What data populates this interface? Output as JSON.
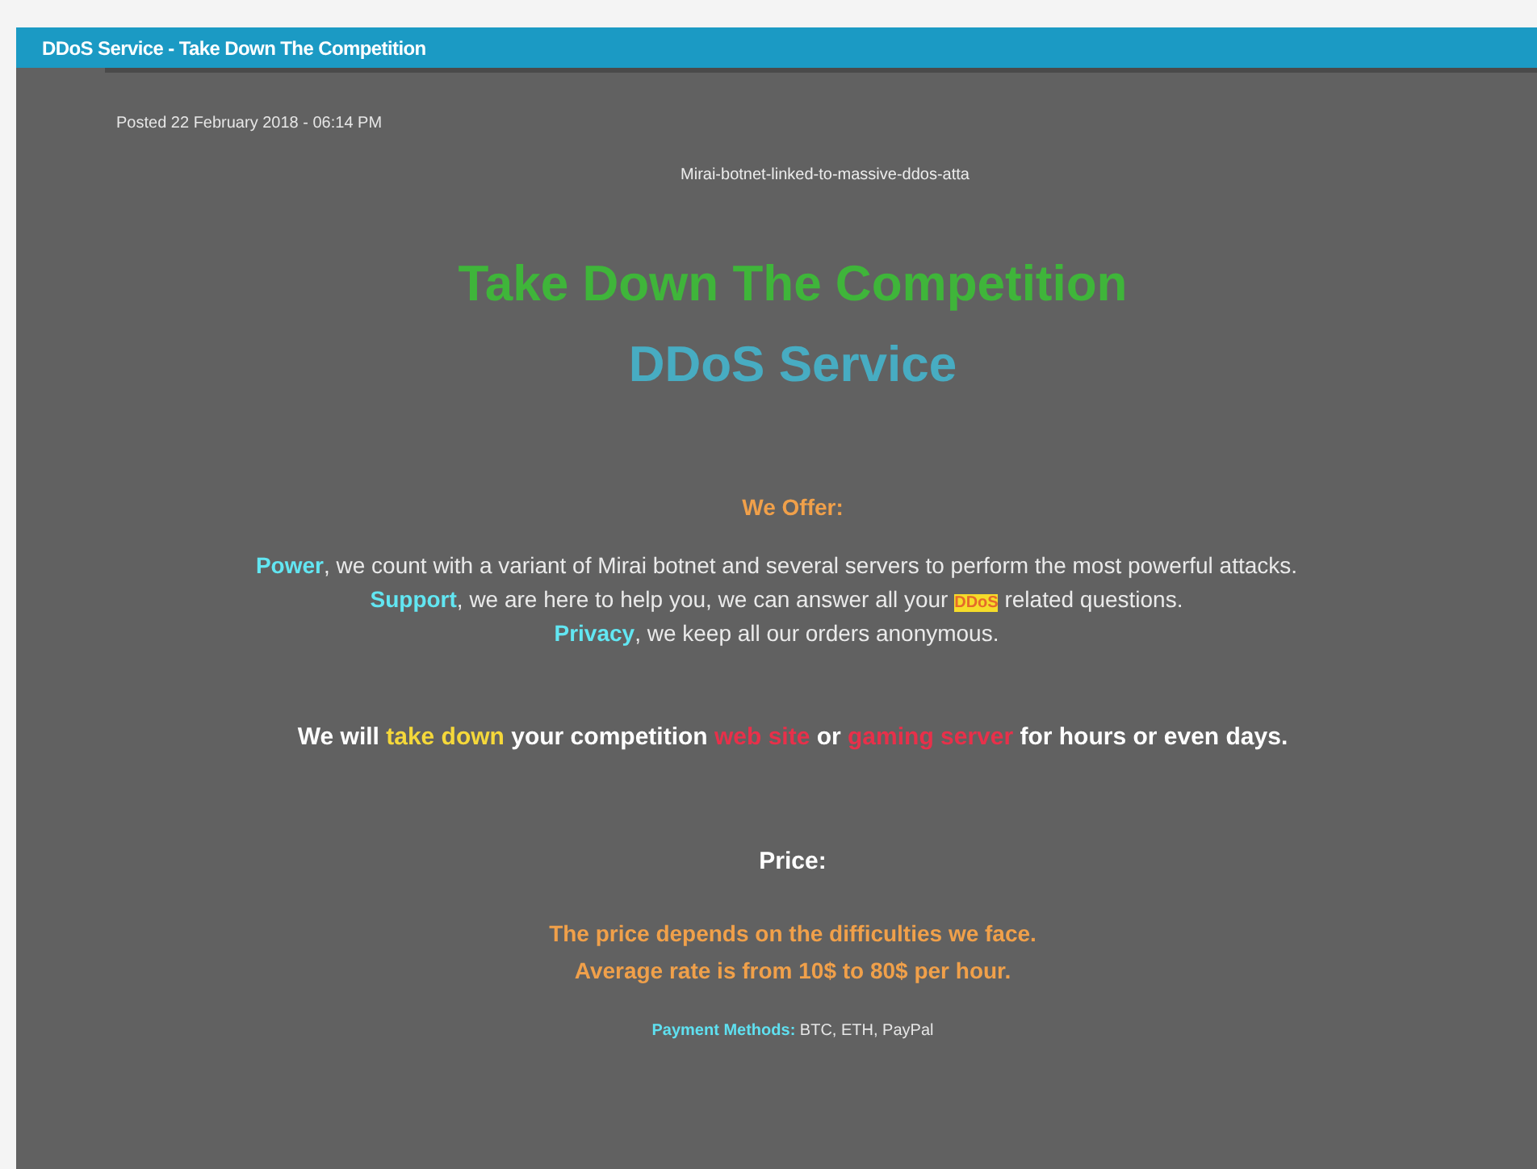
{
  "title_bar": {
    "title": "DDoS Service - Take Down The Competition"
  },
  "post": {
    "posted": "Posted 22 February 2018 - 06:14 PM",
    "image_caption": "Mirai-botnet-linked-to-massive-ddos-atta",
    "headline": "Take Down The Competition",
    "subheadline": "DDoS Service",
    "offer_heading": "We Offer:",
    "offers": [
      {
        "segments": [
          {
            "kind": "lead",
            "text": "Power"
          },
          {
            "kind": "plain",
            "text": ", we count with a variant of Mirai botnet and several servers to perform the most powerful attacks."
          }
        ]
      },
      {
        "segments": [
          {
            "kind": "lead",
            "text": "Support"
          },
          {
            "kind": "plain",
            "text": ", we are here to help you, we can answer all your "
          },
          {
            "kind": "highlight",
            "text": "DDoS"
          },
          {
            "kind": "plain",
            "text": " related questions."
          }
        ]
      },
      {
        "segments": [
          {
            "kind": "lead",
            "text": "Privacy"
          },
          {
            "kind": "plain",
            "text": ", we keep all our orders anonymous."
          }
        ]
      }
    ],
    "pitch": {
      "segments": [
        {
          "kind": "plain",
          "text": "We will "
        },
        {
          "kind": "accent",
          "text": "take down"
        },
        {
          "kind": "plain",
          "text": " your competition "
        },
        {
          "kind": "alert",
          "text": "web site"
        },
        {
          "kind": "plain",
          "text": " or "
        },
        {
          "kind": "alert",
          "text": "gaming server"
        },
        {
          "kind": "plain",
          "text": " for hours or even days."
        }
      ]
    },
    "price_heading": "Price:",
    "price_lines": [
      "The price depends on the difficulties we face.",
      "Average rate is from 10$ to 80$ per hour."
    ],
    "payment": {
      "segments": [
        {
          "kind": "lead",
          "text": "Payment Methods:"
        },
        {
          "kind": "plain",
          "text": " BTC, ETH, PayPal"
        }
      ]
    }
  }
}
